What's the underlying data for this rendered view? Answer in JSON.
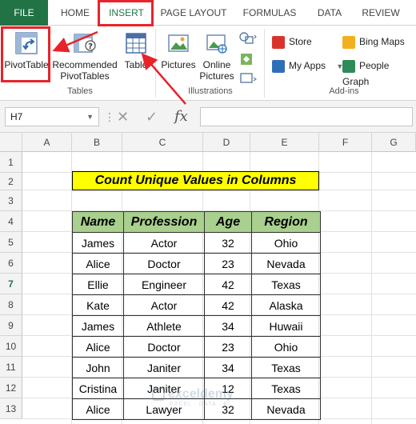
{
  "tabs": [
    {
      "label": "FILE"
    },
    {
      "label": "HOME"
    },
    {
      "label": "INSERT"
    },
    {
      "label": "PAGE LAYOUT"
    },
    {
      "label": "FORMULAS"
    },
    {
      "label": "DATA"
    },
    {
      "label": "REVIEW"
    }
  ],
  "ribbon": {
    "pivot_table": "PivotTable",
    "recommended_1": "Recommended",
    "recommended_2": "PivotTables",
    "table": "Table",
    "group_tables": "Tables",
    "pictures": "Pictures",
    "online_1": "Online",
    "online_2": "Pictures",
    "group_illustrations": "Illustrations",
    "store": "Store",
    "my_apps": "My Apps",
    "bing_maps": "Bing Maps",
    "people_graph": "People Graph",
    "group_addins": "Add-ins"
  },
  "formula_bar": {
    "name_box": "H7",
    "cancel": "✕",
    "enter": "✓",
    "fx": "fx",
    "formula": ""
  },
  "columns": [
    "A",
    "B",
    "C",
    "D",
    "E",
    "F",
    "G"
  ],
  "rows": [
    "1",
    "2",
    "3",
    "4",
    "5",
    "6",
    "7",
    "8",
    "9",
    "10",
    "11",
    "12",
    "13"
  ],
  "sheet": {
    "title": "Count Unique Values in Columns",
    "headers": [
      "Name",
      "Profession",
      "Age",
      "Region"
    ],
    "records": [
      [
        "James",
        "Actor",
        "32",
        "Ohio"
      ],
      [
        "Alice",
        "Doctor",
        "23",
        "Nevada"
      ],
      [
        "Ellie",
        "Engineer",
        "42",
        "Texas"
      ],
      [
        "Kate",
        "Actor",
        "42",
        "Alaska"
      ],
      [
        "James",
        "Athlete",
        "34",
        "Huwaii"
      ],
      [
        "Alice",
        "Doctor",
        "23",
        "Ohio"
      ],
      [
        "John",
        "Janiter",
        "34",
        "Texas"
      ],
      [
        "Cristina",
        "Janiter",
        "12",
        "Texas"
      ],
      [
        "Alice",
        "Lawyer",
        "32",
        "Nevada"
      ]
    ]
  },
  "watermark": {
    "name": "exceldemy",
    "tagline": "EXCEL · DATA · BI"
  },
  "colors": {
    "excel_green": "#217346",
    "highlight_red": "#e8232a",
    "header_green": "#a9d08e",
    "title_yellow": "#ffff00"
  }
}
